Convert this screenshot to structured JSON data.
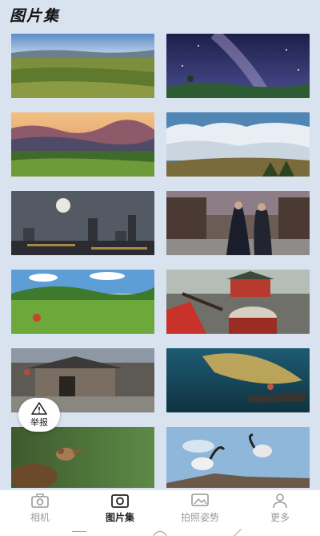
{
  "header": {
    "title": "图片集"
  },
  "gallery": {
    "photos": [
      {
        "icon": "grassland-landscape"
      },
      {
        "icon": "milky-way-night-sky"
      },
      {
        "icon": "mountain-sunset"
      },
      {
        "icon": "sea-of-clouds"
      },
      {
        "icon": "city-night-moon"
      },
      {
        "icon": "couple-old-street"
      },
      {
        "icon": "green-hills-balloon"
      },
      {
        "icon": "drum-performance"
      },
      {
        "icon": "old-village-houses"
      },
      {
        "icon": "fisherman-net"
      },
      {
        "icon": "bird-on-nest"
      },
      {
        "icon": "herons-on-branch"
      }
    ]
  },
  "report_button": {
    "label": "举报",
    "icon": "warning-triangle-icon"
  },
  "tabbar": {
    "tabs": [
      {
        "label": "相机",
        "icon": "camera-icon",
        "active": false
      },
      {
        "label": "图片集",
        "icon": "gallery-icon",
        "active": true
      },
      {
        "label": "拍照姿势",
        "icon": "pose-icon",
        "active": false
      },
      {
        "label": "更多",
        "icon": "person-icon",
        "active": false
      }
    ]
  },
  "colors": {
    "background": "#d9e3ef",
    "active_tab": "#222222",
    "inactive_tab": "#9a9a9a"
  }
}
